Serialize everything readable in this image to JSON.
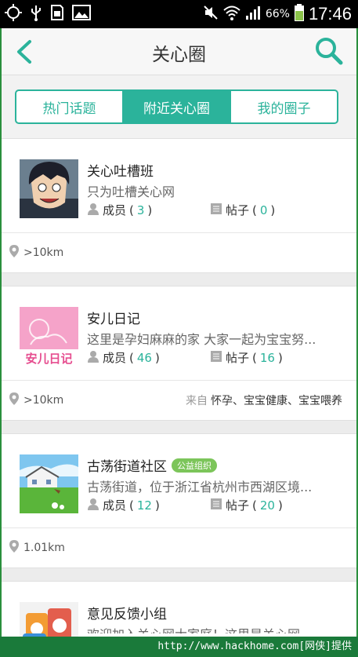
{
  "status_bar": {
    "battery": "66%",
    "time": "17:46"
  },
  "header": {
    "title": "关心圈"
  },
  "tabs": [
    {
      "label": "热门话题",
      "active": false
    },
    {
      "label": "附近关心圈",
      "active": true
    },
    {
      "label": "我的圈子",
      "active": false
    }
  ],
  "cards": [
    {
      "name": "关心吐槽班",
      "desc": "只为吐槽关心网",
      "members_label": "成员",
      "members": "3",
      "posts_label": "帖子",
      "posts": "0",
      "distance": ">10km",
      "from_label": "",
      "from_tags": ""
    },
    {
      "name": "安儿日记",
      "desc": "这里是孕妇麻麻的家 大家一起为宝宝努...",
      "members_label": "成员",
      "members": "46",
      "posts_label": "帖子",
      "posts": "16",
      "distance": ">10km",
      "from_label": "来自",
      "from_tags": "怀孕、宝宝健康、宝宝喂养",
      "thumb_text": "安儿日记"
    },
    {
      "name": "古荡街道社区",
      "badge": "公益组织",
      "desc": "古荡街道，位于浙江省杭州市西湖区境...",
      "members_label": "成员",
      "members": "12",
      "posts_label": "帖子",
      "posts": "20",
      "distance": "1.01km",
      "from_label": "",
      "from_tags": ""
    },
    {
      "name": "意见反馈小组",
      "desc": "欢迎加入关心网大家庭！这里是关心网..."
    }
  ],
  "watermark": "http://www.hackhome.com[网侠]提供",
  "colors": {
    "accent": "#2bb39b",
    "badge": "#7cc55a"
  }
}
